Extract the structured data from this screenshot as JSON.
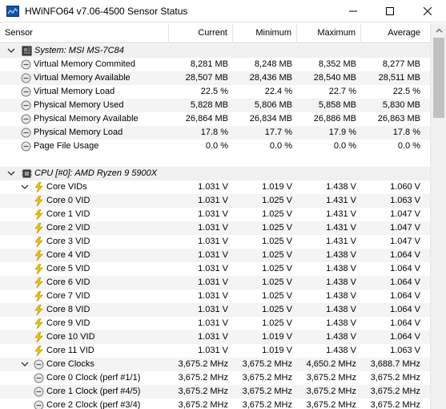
{
  "window": {
    "title": "HWiNFO64 v7.06-4500 Sensor Status"
  },
  "columns": {
    "sensor": "Sensor",
    "current": "Current",
    "minimum": "Minimum",
    "maximum": "Maximum",
    "average": "Average"
  },
  "groups": {
    "system": "System: MSI MS-7C84",
    "cpu": "CPU [#0]: AMD Ryzen 9 5900X"
  },
  "rows": [
    {
      "label": "Virtual Memory Commited",
      "current": "8,281 MB",
      "minimum": "8,248 MB",
      "maximum": "8,352 MB",
      "average": "8,277 MB"
    },
    {
      "label": "Virtual Memory Available",
      "current": "28,507 MB",
      "minimum": "28,436 MB",
      "maximum": "28,540 MB",
      "average": "28,511 MB"
    },
    {
      "label": "Virtual Memory Load",
      "current": "22.5 %",
      "minimum": "22.4 %",
      "maximum": "22.7 %",
      "average": "22.5 %"
    },
    {
      "label": "Physical Memory Used",
      "current": "5,828 MB",
      "minimum": "5,806 MB",
      "maximum": "5,858 MB",
      "average": "5,830 MB"
    },
    {
      "label": "Physical Memory Available",
      "current": "26,864 MB",
      "minimum": "26,834 MB",
      "maximum": "26,886 MB",
      "average": "26,863 MB"
    },
    {
      "label": "Physical Memory Load",
      "current": "17.8 %",
      "minimum": "17.7 %",
      "maximum": "17.9 %",
      "average": "17.8 %"
    },
    {
      "label": "Page File Usage",
      "current": "0.0 %",
      "minimum": "0.0 %",
      "maximum": "0.0 %",
      "average": "0.0 %"
    },
    {
      "label": "Core VIDs",
      "current": "1.031 V",
      "minimum": "1.019 V",
      "maximum": "1.438 V",
      "average": "1.060 V"
    },
    {
      "label": "Core 0 VID",
      "current": "1.031 V",
      "minimum": "1.025 V",
      "maximum": "1.431 V",
      "average": "1.063 V"
    },
    {
      "label": "Core 1 VID",
      "current": "1.031 V",
      "minimum": "1.025 V",
      "maximum": "1.431 V",
      "average": "1.047 V"
    },
    {
      "label": "Core 2 VID",
      "current": "1.031 V",
      "minimum": "1.025 V",
      "maximum": "1.431 V",
      "average": "1.047 V"
    },
    {
      "label": "Core 3 VID",
      "current": "1.031 V",
      "minimum": "1.025 V",
      "maximum": "1.431 V",
      "average": "1.047 V"
    },
    {
      "label": "Core 4 VID",
      "current": "1.031 V",
      "minimum": "1.025 V",
      "maximum": "1.438 V",
      "average": "1.064 V"
    },
    {
      "label": "Core 5 VID",
      "current": "1.031 V",
      "minimum": "1.025 V",
      "maximum": "1.438 V",
      "average": "1.064 V"
    },
    {
      "label": "Core 6 VID",
      "current": "1.031 V",
      "minimum": "1.025 V",
      "maximum": "1.438 V",
      "average": "1.064 V"
    },
    {
      "label": "Core 7 VID",
      "current": "1.031 V",
      "minimum": "1.025 V",
      "maximum": "1.438 V",
      "average": "1.064 V"
    },
    {
      "label": "Core 8 VID",
      "current": "1.031 V",
      "minimum": "1.025 V",
      "maximum": "1.438 V",
      "average": "1.064 V"
    },
    {
      "label": "Core 9 VID",
      "current": "1.031 V",
      "minimum": "1.025 V",
      "maximum": "1.438 V",
      "average": "1.064 V"
    },
    {
      "label": "Core 10 VID",
      "current": "1.031 V",
      "minimum": "1.019 V",
      "maximum": "1.438 V",
      "average": "1.064 V"
    },
    {
      "label": "Core 11 VID",
      "current": "1.031 V",
      "minimum": "1.019 V",
      "maximum": "1.438 V",
      "average": "1.063 V"
    },
    {
      "label": "Core Clocks",
      "current": "3,675.2 MHz",
      "minimum": "3,675.2 MHz",
      "maximum": "4,650.2 MHz",
      "average": "3,688.7 MHz"
    },
    {
      "label": "Core 0 Clock (perf #1/1)",
      "current": "3,675.2 MHz",
      "minimum": "3,675.2 MHz",
      "maximum": "3,675.2 MHz",
      "average": "3,675.2 MHz"
    },
    {
      "label": "Core 1 Clock (perf #4/5)",
      "current": "3,675.2 MHz",
      "minimum": "3,675.2 MHz",
      "maximum": "3,675.2 MHz",
      "average": "3,675.2 MHz"
    },
    {
      "label": "Core 2 Clock (perf #3/4)",
      "current": "3,675.2 MHz",
      "minimum": "3,675.2 MHz",
      "maximum": "3,675.2 MHz",
      "average": "3,675.2 MHz"
    }
  ],
  "icons": {
    "window": "sensor-status-icon",
    "memory_sensor": "gauge-icon",
    "voltage_sensor": "lightning-bolt-icon",
    "clock_sensor": "clock-gauge-icon",
    "system_group": "motherboard-icon",
    "cpu_group": "cpu-chip-icon",
    "chevron": "chevron-down-icon"
  },
  "colors": {
    "voltage_icon": "#f4c400",
    "gauge_icon": "#8a8a8a",
    "group_row": "#f0f0f0",
    "alt_row": "#f4f4f4"
  }
}
